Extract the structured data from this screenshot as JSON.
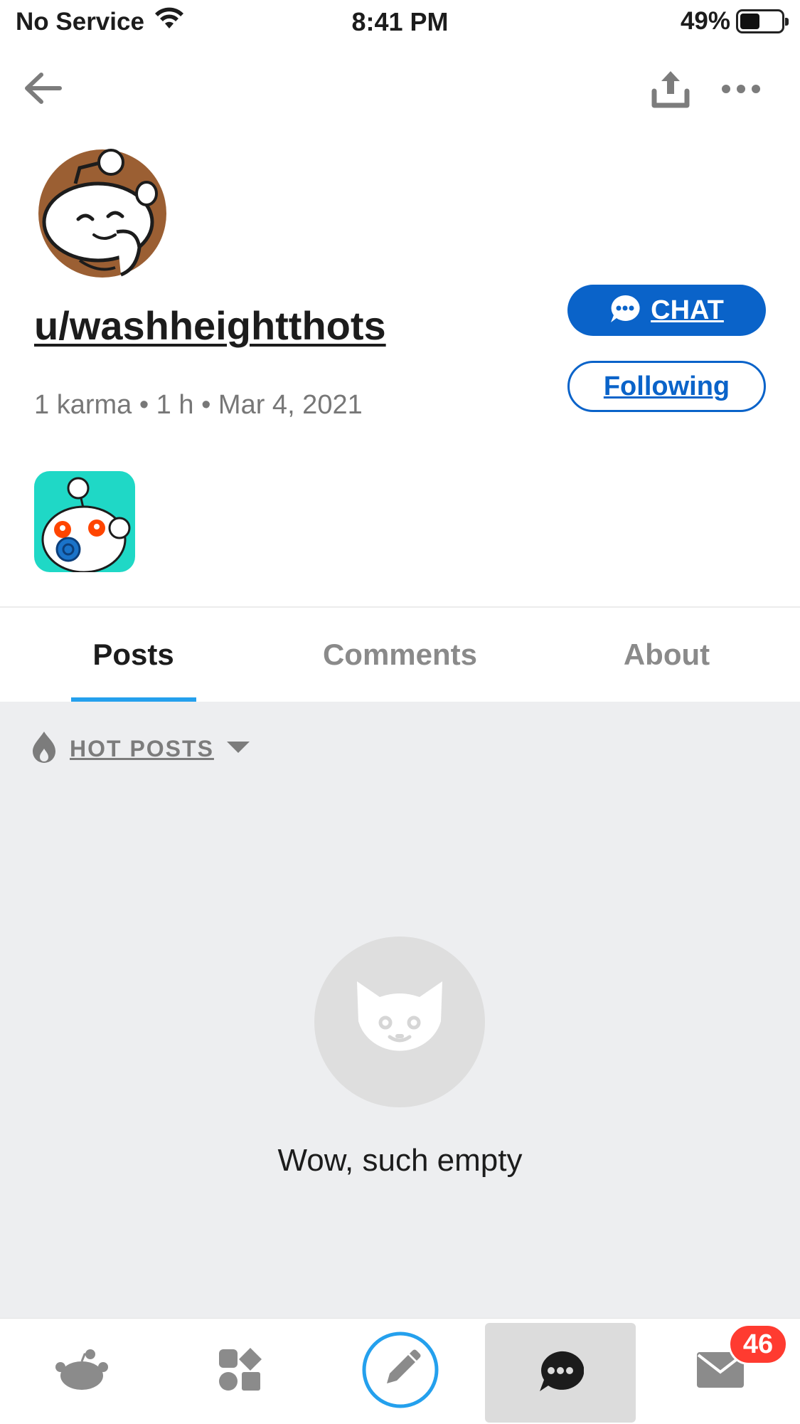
{
  "status_bar": {
    "carrier": "No Service",
    "time": "8:41 PM",
    "battery_percent": "49%",
    "battery_level": 0.49
  },
  "nav": {
    "back_icon": "arrow-left-icon",
    "share_icon": "share-icon",
    "more_icon": "more-horizontal-icon"
  },
  "profile": {
    "username": "u/washheightthots",
    "meta": "1 karma • 1 h • Mar 4, 2021",
    "chat_label": "CHAT",
    "following_label": "Following"
  },
  "tabs": [
    {
      "label": "Posts",
      "active": true
    },
    {
      "label": "Comments",
      "active": false
    },
    {
      "label": "About",
      "active": false
    }
  ],
  "feed": {
    "sort_label": "HOT POSTS",
    "empty_text": "Wow, such empty"
  },
  "bottom_bar": {
    "items": [
      "home",
      "communities",
      "create-post",
      "chat",
      "inbox"
    ],
    "inbox_badge": "46"
  },
  "colors": {
    "accent": "#0a63c9",
    "tab_indicator": "#24a0ed",
    "badge": "#ff3b30",
    "background_gray": "#edeef0"
  }
}
